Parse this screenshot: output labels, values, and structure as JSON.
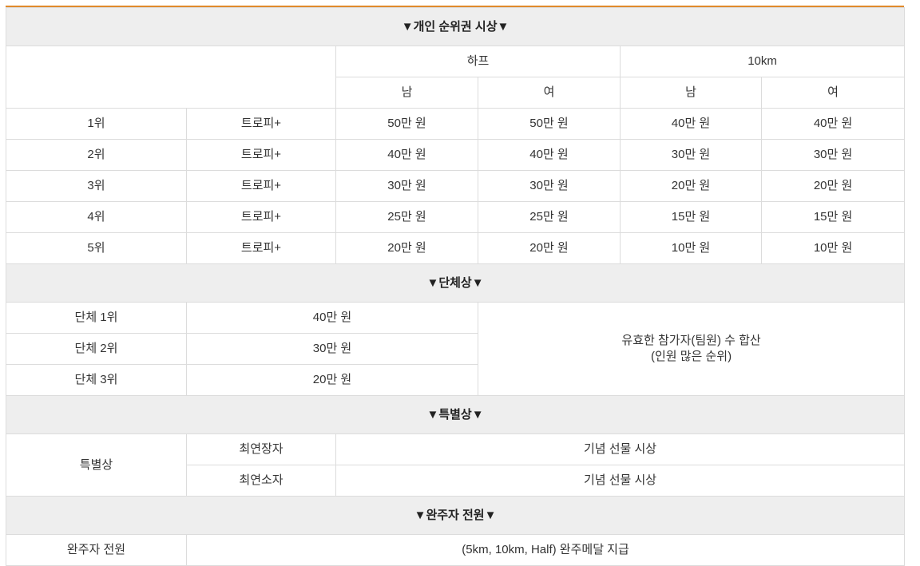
{
  "sections": {
    "individual": "▼개인 순위권 시상▼",
    "group": "▼단체상▼",
    "special": "▼특별상▼",
    "finisher": "▼완주자 전원▼"
  },
  "individual": {
    "courses": [
      "하프",
      "10km"
    ],
    "genders": [
      "남",
      "여",
      "남",
      "여"
    ],
    "rows": [
      {
        "rank": "1위",
        "prize": "트로피+",
        "values": [
          "50만 원",
          "50만 원",
          "40만 원",
          "40만 원"
        ]
      },
      {
        "rank": "2위",
        "prize": "트로피+",
        "values": [
          "40만 원",
          "40만 원",
          "30만 원",
          "30만 원"
        ]
      },
      {
        "rank": "3위",
        "prize": "트로피+",
        "values": [
          "30만 원",
          "30만 원",
          "20만 원",
          "20만 원"
        ]
      },
      {
        "rank": "4위",
        "prize": "트로피+",
        "values": [
          "25만 원",
          "25만 원",
          "15만 원",
          "15만 원"
        ]
      },
      {
        "rank": "5위",
        "prize": "트로피+",
        "values": [
          "20만 원",
          "20만 원",
          "10만 원",
          "10만 원"
        ]
      }
    ]
  },
  "group": {
    "rows": [
      {
        "rank": "단체 1위",
        "amount": "40만 원"
      },
      {
        "rank": "단체 2위",
        "amount": "30만 원"
      },
      {
        "rank": "단체 3위",
        "amount": "20만 원"
      }
    ],
    "note_line1": "유효한 참가자(팀원) 수 합산",
    "note_line2": "(인원 많은 순위)"
  },
  "special": {
    "label": "특별상",
    "rows": [
      {
        "name": "최연장자",
        "reward": "기념 선물 시상"
      },
      {
        "name": "최연소자",
        "reward": "기념 선물 시상"
      }
    ]
  },
  "finisher": {
    "label": "완주자 전원",
    "reward": "(5km, 10km, Half) 완주메달 지급"
  }
}
